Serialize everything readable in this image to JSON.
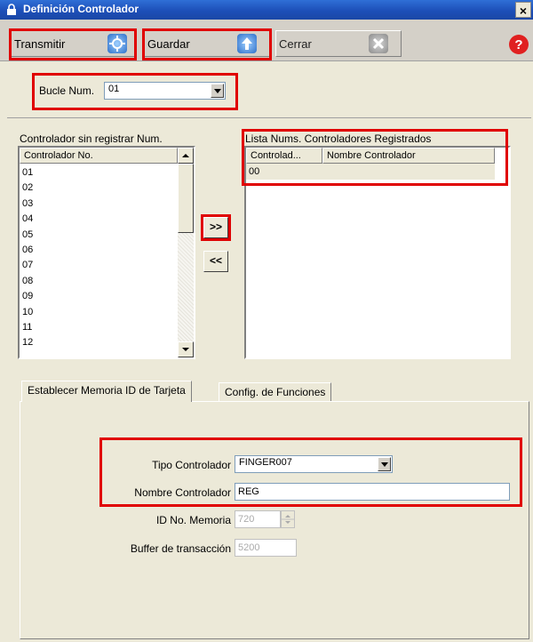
{
  "window": {
    "title": "Definición Controlador",
    "close_glyph": "×"
  },
  "toolbar": {
    "transmit_label": "Transmitir",
    "save_label": "Guardar",
    "close_label": "Cerrar",
    "help_icon": "help-icon"
  },
  "loop": {
    "label": "Bucle Num.",
    "value": "01"
  },
  "unregistered": {
    "title": "Controlador sin registrar Num.",
    "column": "Controlador No.",
    "items": [
      "01",
      "02",
      "03",
      "04",
      "05",
      "06",
      "07",
      "08",
      "09",
      "10",
      "11",
      "12"
    ]
  },
  "transfer": {
    "add_label": ">>",
    "remove_label": "<<"
  },
  "registered": {
    "title": "Lista Nums. Controladores Registrados",
    "columns": [
      "Controlad...",
      "Nombre Controlador"
    ],
    "rows": [
      {
        "number": "00",
        "name": ""
      }
    ]
  },
  "tabs": [
    {
      "label": "Establecer Memoria ID de Tarjeta"
    },
    {
      "label": "Config. de Funciones"
    }
  ],
  "form": {
    "type_label": "Tipo Controlador",
    "type_value": "FINGER007",
    "name_label": "Nombre Controlador",
    "name_value": "REG",
    "memory_label": "ID No. Memoria",
    "memory_value": "720",
    "buffer_label": "Buffer de transacción",
    "buffer_value": "5200"
  },
  "colors": {
    "highlight": "#e00000",
    "title_bar": "#1d4fb8"
  }
}
